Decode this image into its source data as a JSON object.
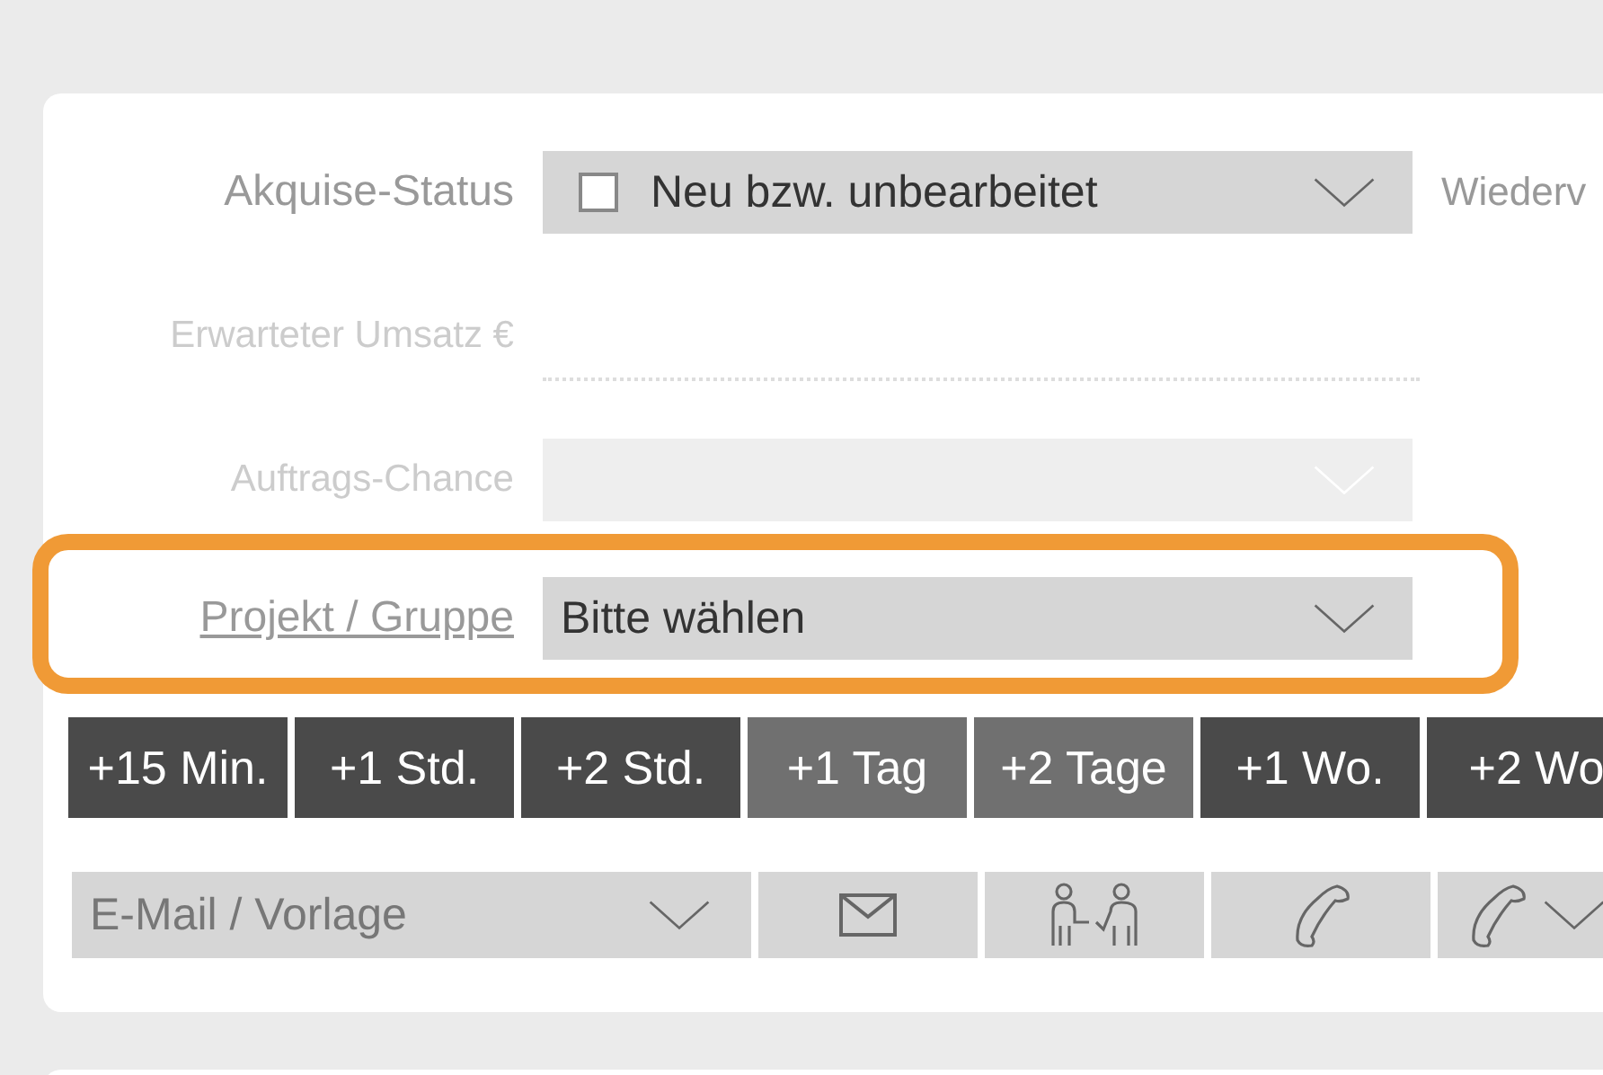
{
  "fields": [
    {
      "label": "Akquise-Status",
      "kind": "select",
      "checkbox": {
        "checked": false
      },
      "value": "Neu bzw. unbearbeitet",
      "disabled": false,
      "highlighted": false,
      "link": false
    },
    {
      "label": "Erwarteter Umsatz €",
      "kind": "text",
      "disabled": true,
      "highlighted": false,
      "link": false
    },
    {
      "label": "Auftrags-Chance",
      "kind": "select",
      "disabled": true,
      "highlighted": false,
      "link": false
    },
    {
      "label": "Projekt / Gruppe",
      "kind": "select",
      "value": "Bitte wählen",
      "disabled": false,
      "highlighted": true,
      "link": true
    }
  ],
  "side_label": "Wiederv",
  "quick_buttons": [
    {
      "label": "+15 Min.",
      "kind": "dark"
    },
    {
      "label": "+1 Std.",
      "kind": "dark"
    },
    {
      "label": "+2 Std.",
      "kind": "dark"
    },
    {
      "label": "+1 Tag",
      "kind": "light"
    },
    {
      "label": "+2 Tage",
      "kind": "light"
    },
    {
      "label": "+1 Wo.",
      "kind": "dark"
    },
    {
      "label": "+2 Wo",
      "kind": "dark"
    }
  ],
  "template_select": {
    "placeholder": "E-Mail / Vorlage"
  }
}
